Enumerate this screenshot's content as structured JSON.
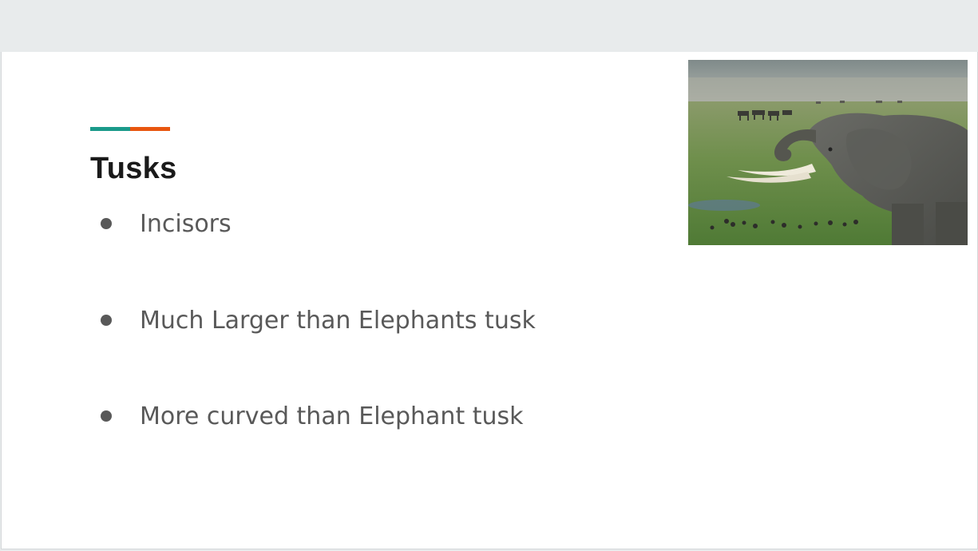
{
  "slide": {
    "title": "Tusks",
    "bullets": [
      "Incisors",
      "Much Larger than Elephants tusk",
      "More curved than Elephant tusk"
    ],
    "accent_colors": [
      "#1a9a8a",
      "#e8560f"
    ],
    "image_subject": "elephant-photo"
  }
}
